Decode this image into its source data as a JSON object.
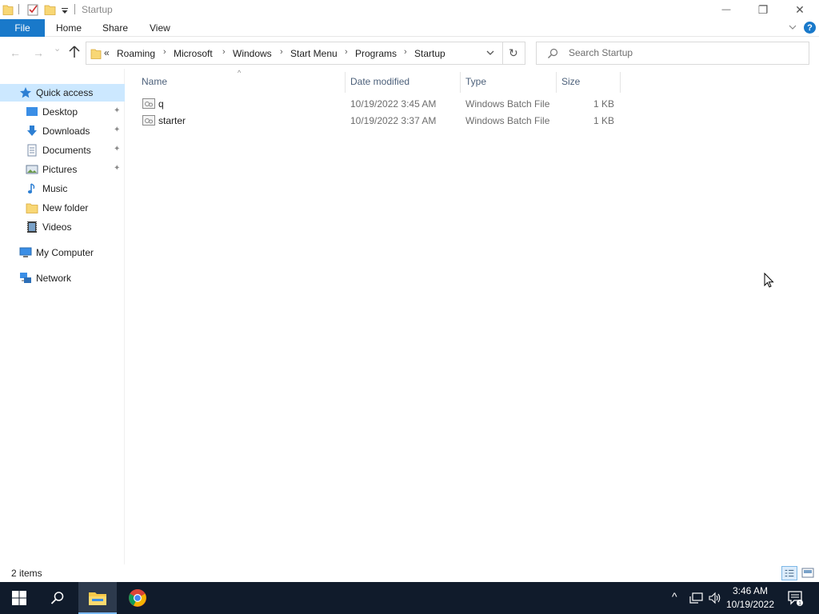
{
  "window": {
    "title": "Startup",
    "min_glyph": "—",
    "restore_glyph": "❐",
    "close_glyph": "✕"
  },
  "ribbon": {
    "file_label": "File",
    "tabs": [
      "Home",
      "Share",
      "View"
    ],
    "help_glyph": "?"
  },
  "navigation": {
    "back_glyph": "←",
    "forward_glyph": "→",
    "recent_glyph": "⌄",
    "chevrons": "«",
    "breadcrumbs": [
      "Roaming",
      "Microsoft",
      "Windows",
      "Start Menu",
      "Programs",
      "Startup"
    ],
    "separator": "›",
    "refresh_glyph": "↻",
    "dropdown_glyph": "⌄"
  },
  "search": {
    "placeholder": "Search Startup",
    "value": ""
  },
  "sidebar": {
    "items": [
      {
        "label": "Quick access",
        "icon": "star-icon",
        "pinned": false,
        "selected": true
      },
      {
        "label": "Desktop",
        "icon": "desktop-icon",
        "pinned": true
      },
      {
        "label": "Downloads",
        "icon": "downloads-icon",
        "pinned": true
      },
      {
        "label": "Documents",
        "icon": "documents-icon",
        "pinned": true
      },
      {
        "label": "Pictures",
        "icon": "pictures-icon",
        "pinned": true
      },
      {
        "label": "Music",
        "icon": "music-icon",
        "pinned": false
      },
      {
        "label": "New folder",
        "icon": "folder-icon",
        "pinned": false
      },
      {
        "label": "Videos",
        "icon": "videos-icon",
        "pinned": false
      },
      {
        "label": "My Computer",
        "icon": "computer-icon",
        "pinned": false
      },
      {
        "label": "Network",
        "icon": "network-icon",
        "pinned": false
      }
    ],
    "pin_glyph": "📌"
  },
  "file_list": {
    "columns": [
      "Name",
      "Date modified",
      "Type",
      "Size"
    ],
    "sort_glyph": "^",
    "rows": [
      {
        "name": "q",
        "date": "10/19/2022 3:45 AM",
        "type": "Windows Batch File",
        "size": "1 KB"
      },
      {
        "name": "starter",
        "date": "10/19/2022 3:37 AM",
        "type": "Windows Batch File",
        "size": "1 KB"
      }
    ]
  },
  "status": {
    "items_text": "2 items"
  },
  "taskbar": {
    "time": "3:46 AM",
    "date": "10/19/2022",
    "tray_chevron": "^"
  },
  "colors": {
    "accent": "#1979ca",
    "selection": "#cce8ff",
    "taskbar": "#101b2b",
    "folder": "#f8d775"
  }
}
